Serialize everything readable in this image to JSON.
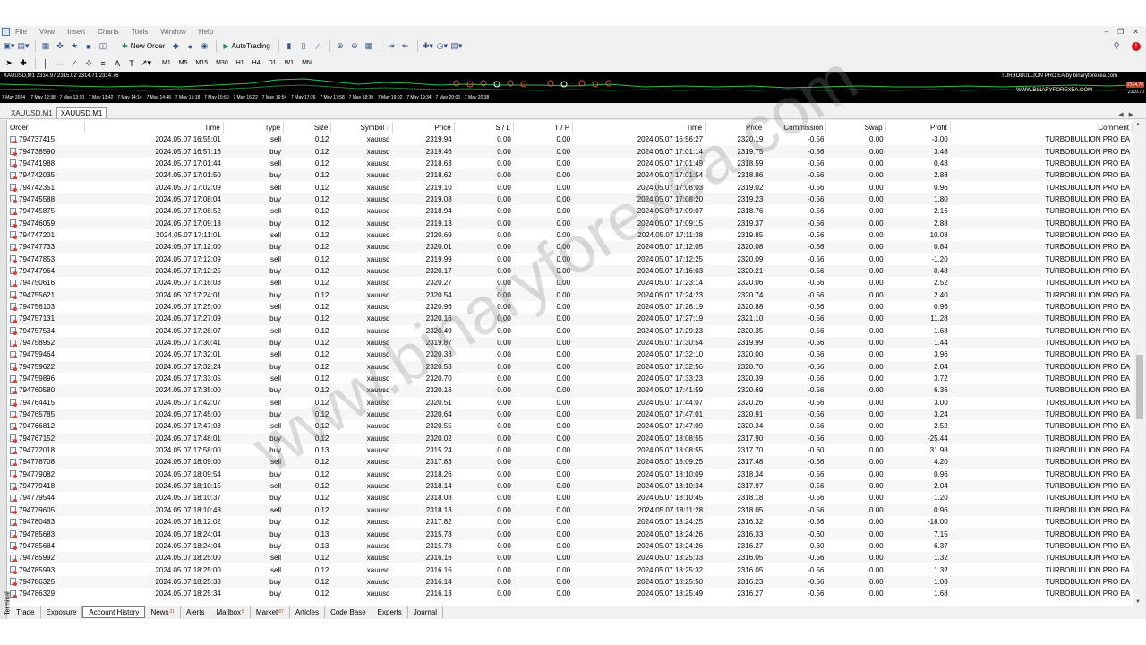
{
  "menu": [
    "File",
    "View",
    "Insert",
    "Charts",
    "Tools",
    "Window",
    "Help"
  ],
  "toolbar": {
    "new_order": "New Order",
    "autotrading": "AutoTrading"
  },
  "timeframes": [
    "M1",
    "M5",
    "M15",
    "M30",
    "H1",
    "H4",
    "D1",
    "W1",
    "MN"
  ],
  "chart": {
    "info": "XAUUSD,M1 2314.97 2315.02 2314.71 2314.76",
    "ea_label": "TURBOBULLION PRO EA by binaryforexea.com",
    "site": "WWW.BINARYFOREXEA.COM",
    "price_box": "2314.76",
    "price_label": "2310.70",
    "time_labels": [
      "7 May 2024",
      "7 May 12:38",
      "7 May 13:10",
      "7 May 13:42",
      "7 May 14:14",
      "7 May 14:46",
      "7 May 15:18",
      "7 May 15:50",
      "7 May 16:22",
      "7 May 16:54",
      "7 May 17:26",
      "7 May 17:58",
      "7 May 18:30",
      "7 May 19:02",
      "7 May 19:34",
      "7 May 20:06",
      "7 May 20:38"
    ]
  },
  "chart_tabs": [
    "XAUUSD,M1",
    "XAUUSD,M1"
  ],
  "terminal_label": "Terminal",
  "columns": {
    "order": "Order",
    "time": "Time",
    "type": "Type",
    "size": "Size",
    "symbol": "Symbol",
    "price": "Price",
    "sl": "S / L",
    "tp": "T / P",
    "close_time": "Time",
    "close_price": "Price",
    "commission": "Commission",
    "swap": "Swap",
    "profit": "Profit",
    "comment": "Comment"
  },
  "rows": [
    [
      "794737415",
      "2024.05.07 16:55:01",
      "sell",
      "0.12",
      "xauusd",
      "2319.94",
      "0.00",
      "0.00",
      "2024.05.07 16:56:27",
      "2320.19",
      "-0.56",
      "0.00",
      "-3.00",
      "TURBOBULLION PRO EA"
    ],
    [
      "794738590",
      "2024.05.07 16:57:16",
      "buy",
      "0.12",
      "xauusd",
      "2319.46",
      "0.00",
      "0.00",
      "2024.05.07 17:01:14",
      "2319.75",
      "-0.56",
      "0.00",
      "3.48",
      "TURBOBULLION PRO EA"
    ],
    [
      "794741988",
      "2024.05.07 17:01:44",
      "sell",
      "0.12",
      "xauusd",
      "2318.63",
      "0.00",
      "0.00",
      "2024.05.07 17:01:49",
      "2318.59",
      "-0.56",
      "0.00",
      "0.48",
      "TURBOBULLION PRO EA"
    ],
    [
      "794742035",
      "2024.05.07 17:01:50",
      "buy",
      "0.12",
      "xauusd",
      "2318.62",
      "0.00",
      "0.00",
      "2024.05.07 17:01:54",
      "2318.86",
      "-0.56",
      "0.00",
      "2.88",
      "TURBOBULLION PRO EA"
    ],
    [
      "794742351",
      "2024.05.07 17:02:09",
      "sell",
      "0.12",
      "xauusd",
      "2319.10",
      "0.00",
      "0.00",
      "2024.05.07 17:08:03",
      "2319.02",
      "-0.56",
      "0.00",
      "0.96",
      "TURBOBULLION PRO EA"
    ],
    [
      "794745588",
      "2024.05.07 17:08:04",
      "buy",
      "0.12",
      "xauusd",
      "2319.08",
      "0.00",
      "0.00",
      "2024.05.07 17:08:20",
      "2319.23",
      "-0.56",
      "0.00",
      "1.80",
      "TURBOBULLION PRO EA"
    ],
    [
      "794745875",
      "2024.05.07 17:08:52",
      "sell",
      "0.12",
      "xauusd",
      "2318.94",
      "0.00",
      "0.00",
      "2024.05.07 17:09:07",
      "2318.76",
      "-0.56",
      "0.00",
      "2.16",
      "TURBOBULLION PRO EA"
    ],
    [
      "794746059",
      "2024.05.07 17:09:13",
      "buy",
      "0.12",
      "xauusd",
      "2319.13",
      "0.00",
      "0.00",
      "2024.05.07 17:09:15",
      "2319.37",
      "-0.56",
      "0.00",
      "2.88",
      "TURBOBULLION PRO EA"
    ],
    [
      "794747201",
      "2024.05.07 17:11:01",
      "sell",
      "0.12",
      "xauusd",
      "2320.69",
      "0.00",
      "0.00",
      "2024.05.07 17:11:38",
      "2319.85",
      "-0.56",
      "0.00",
      "10.08",
      "TURBOBULLION PRO EA"
    ],
    [
      "794747733",
      "2024.05.07 17:12:00",
      "buy",
      "0.12",
      "xauusd",
      "2320.01",
      "0.00",
      "0.00",
      "2024.05.07 17:12:05",
      "2320.08",
      "-0.56",
      "0.00",
      "0.84",
      "TURBOBULLION PRO EA"
    ],
    [
      "794747853",
      "2024.05.07 17:12:09",
      "sell",
      "0.12",
      "xauusd",
      "2319.99",
      "0.00",
      "0.00",
      "2024.05.07 17:12:25",
      "2320.09",
      "-0.56",
      "0.00",
      "-1.20",
      "TURBOBULLION PRO EA"
    ],
    [
      "794747964",
      "2024.05.07 17:12:25",
      "buy",
      "0.12",
      "xauusd",
      "2320.17",
      "0.00",
      "0.00",
      "2024.05.07 17:16:03",
      "2320.21",
      "-0.56",
      "0.00",
      "0.48",
      "TURBOBULLION PRO EA"
    ],
    [
      "794750616",
      "2024.05.07 17:16:03",
      "sell",
      "0.12",
      "xauusd",
      "2320.27",
      "0.00",
      "0.00",
      "2024.05.07 17:23:14",
      "2320.06",
      "-0.56",
      "0.00",
      "2.52",
      "TURBOBULLION PRO EA"
    ],
    [
      "794755621",
      "2024.05.07 17:24:01",
      "buy",
      "0.12",
      "xauusd",
      "2320.54",
      "0.00",
      "0.00",
      "2024.05.07 17:24:23",
      "2320.74",
      "-0.56",
      "0.00",
      "2.40",
      "TURBOBULLION PRO EA"
    ],
    [
      "794756103",
      "2024.05.07 17:25:00",
      "sell",
      "0.12",
      "xauusd",
      "2320.96",
      "0.00",
      "0.00",
      "2024.05.07 17:26:19",
      "2320.88",
      "-0.56",
      "0.00",
      "0.96",
      "TURBOBULLION PRO EA"
    ],
    [
      "794757131",
      "2024.05.07 17:27:09",
      "buy",
      "0.12",
      "xauusd",
      "2320.16",
      "0.00",
      "0.00",
      "2024.05.07 17:27:19",
      "2321.10",
      "-0.56",
      "0.00",
      "11.28",
      "TURBOBULLION PRO EA"
    ],
    [
      "794757534",
      "2024.05.07 17:28:07",
      "sell",
      "0.12",
      "xauusd",
      "2320.49",
      "0.00",
      "0.00",
      "2024.05.07 17:29:23",
      "2320.35",
      "-0.56",
      "0.00",
      "1.68",
      "TURBOBULLION PRO EA"
    ],
    [
      "794758952",
      "2024.05.07 17:30:41",
      "buy",
      "0.12",
      "xauusd",
      "2319.87",
      "0.00",
      "0.00",
      "2024.05.07 17:30:54",
      "2319.99",
      "-0.56",
      "0.00",
      "1.44",
      "TURBOBULLION PRO EA"
    ],
    [
      "794759464",
      "2024.05.07 17:32:01",
      "sell",
      "0.12",
      "xauusd",
      "2320.33",
      "0.00",
      "0.00",
      "2024.05.07 17:32:10",
      "2320.00",
      "-0.56",
      "0.00",
      "3.96",
      "TURBOBULLION PRO EA"
    ],
    [
      "794759622",
      "2024.05.07 17:32:24",
      "buy",
      "0.12",
      "xauusd",
      "2320.53",
      "0.00",
      "0.00",
      "2024.05.07 17:32:56",
      "2320.70",
      "-0.56",
      "0.00",
      "2.04",
      "TURBOBULLION PRO EA"
    ],
    [
      "794759896",
      "2024.05.07 17:33:05",
      "sell",
      "0.12",
      "xauusd",
      "2320.70",
      "0.00",
      "0.00",
      "2024.05.07 17:33:23",
      "2320.39",
      "-0.56",
      "0.00",
      "3.72",
      "TURBOBULLION PRO EA"
    ],
    [
      "794760580",
      "2024.05.07 17:35:00",
      "buy",
      "0.12",
      "xauusd",
      "2320.16",
      "0.00",
      "0.00",
      "2024.05.07 17:41:59",
      "2320.69",
      "-0.56",
      "0.00",
      "6.36",
      "TURBOBULLION PRO EA"
    ],
    [
      "794764415",
      "2024.05.07 17:42:07",
      "sell",
      "0.12",
      "xauusd",
      "2320.51",
      "0.00",
      "0.00",
      "2024.05.07 17:44:07",
      "2320.26",
      "-0.56",
      "0.00",
      "3.00",
      "TURBOBULLION PRO EA"
    ],
    [
      "794765785",
      "2024.05.07 17:45:00",
      "buy",
      "0.12",
      "xauusd",
      "2320.64",
      "0.00",
      "0.00",
      "2024.05.07 17:47:01",
      "2320.91",
      "-0.56",
      "0.00",
      "3.24",
      "TURBOBULLION PRO EA"
    ],
    [
      "794766812",
      "2024.05.07 17:47:03",
      "sell",
      "0.12",
      "xauusd",
      "2320.55",
      "0.00",
      "0.00",
      "2024.05.07 17:47:09",
      "2320.34",
      "-0.56",
      "0.00",
      "2.52",
      "TURBOBULLION PRO EA"
    ],
    [
      "794767152",
      "2024.05.07 17:48:01",
      "buy",
      "0.12",
      "xauusd",
      "2320.02",
      "0.00",
      "0.00",
      "2024.05.07 18:08:55",
      "2317.90",
      "-0.56",
      "0.00",
      "-25.44",
      "TURBOBULLION PRO EA"
    ],
    [
      "794772018",
      "2024.05.07 17:58:00",
      "buy",
      "0.13",
      "xauusd",
      "2315.24",
      "0.00",
      "0.00",
      "2024.05.07 18:08:55",
      "2317.70",
      "-0.60",
      "0.00",
      "31.98",
      "TURBOBULLION PRO EA"
    ],
    [
      "794778708",
      "2024.05.07 18:09:00",
      "sell",
      "0.12",
      "xauusd",
      "2317.83",
      "0.00",
      "0.00",
      "2024.05.07 18:09:25",
      "2317.48",
      "-0.56",
      "0.00",
      "4.20",
      "TURBOBULLION PRO EA"
    ],
    [
      "794779082",
      "2024.05.07 18:09:54",
      "buy",
      "0.12",
      "xauusd",
      "2318.26",
      "0.00",
      "0.00",
      "2024.05.07 18:10:09",
      "2318.34",
      "-0.56",
      "0.00",
      "0.96",
      "TURBOBULLION PRO EA"
    ],
    [
      "794779418",
      "2024.05.07 18:10:15",
      "sell",
      "0.12",
      "xauusd",
      "2318.14",
      "0.00",
      "0.00",
      "2024.05.07 18:10:34",
      "2317.97",
      "-0.56",
      "0.00",
      "2.04",
      "TURBOBULLION PRO EA"
    ],
    [
      "794779544",
      "2024.05.07 18:10:37",
      "buy",
      "0.12",
      "xauusd",
      "2318.08",
      "0.00",
      "0.00",
      "2024.05.07 18:10:45",
      "2318.18",
      "-0.56",
      "0.00",
      "1.20",
      "TURBOBULLION PRO EA"
    ],
    [
      "794779605",
      "2024.05.07 18:10:48",
      "sell",
      "0.12",
      "xauusd",
      "2318.13",
      "0.00",
      "0.00",
      "2024.05.07 18:11:28",
      "2318.05",
      "-0.56",
      "0.00",
      "0.96",
      "TURBOBULLION PRO EA"
    ],
    [
      "794780483",
      "2024.05.07 18:12:02",
      "buy",
      "0.12",
      "xauusd",
      "2317.82",
      "0.00",
      "0.00",
      "2024.05.07 18:24:25",
      "2316.32",
      "-0.56",
      "0.00",
      "-18.00",
      "TURBOBULLION PRO EA"
    ],
    [
      "794785683",
      "2024.05.07 18:24:04",
      "buy",
      "0.13",
      "xauusd",
      "2315.78",
      "0.00",
      "0.00",
      "2024.05.07 18:24:26",
      "2316.33",
      "-0.60",
      "0.00",
      "7.15",
      "TURBOBULLION PRO EA"
    ],
    [
      "794785684",
      "2024.05.07 18:24:04",
      "buy",
      "0.13",
      "xauusd",
      "2315.78",
      "0.00",
      "0.00",
      "2024.05.07 18:24:26",
      "2316.27",
      "-0.60",
      "0.00",
      "6.37",
      "TURBOBULLION PRO EA"
    ],
    [
      "794785992",
      "2024.05.07 18:25:00",
      "sell",
      "0.12",
      "xauusd",
      "2316.16",
      "0.00",
      "0.00",
      "2024.05.07 18:25:33",
      "2316.05",
      "-0.56",
      "0.00",
      "1.32",
      "TURBOBULLION PRO EA"
    ],
    [
      "794785993",
      "2024.05.07 18:25:00",
      "sell",
      "0.12",
      "xauusd",
      "2316.16",
      "0.00",
      "0.00",
      "2024.05.07 18:25:32",
      "2316.05",
      "-0.56",
      "0.00",
      "1.32",
      "TURBOBULLION PRO EA"
    ],
    [
      "794786325",
      "2024.05.07 18:25:33",
      "buy",
      "0.12",
      "xauusd",
      "2316.14",
      "0.00",
      "0.00",
      "2024.05.07 18:25:50",
      "2316.23",
      "-0.56",
      "0.00",
      "1.08",
      "TURBOBULLION PRO EA"
    ],
    [
      "794786329",
      "2024.05.07 18:25:34",
      "buy",
      "0.12",
      "xauusd",
      "2316.13",
      "0.00",
      "0.00",
      "2024.05.07 18:25:49",
      "2316.27",
      "-0.56",
      "0.00",
      "1.68",
      "TURBOBULLION PRO EA"
    ]
  ],
  "bottom_tabs": [
    {
      "label": "Trade",
      "badge": ""
    },
    {
      "label": "Exposure",
      "badge": ""
    },
    {
      "label": "Account History",
      "badge": ""
    },
    {
      "label": "News",
      "badge": "21"
    },
    {
      "label": "Alerts",
      "badge": ""
    },
    {
      "label": "Mailbox",
      "badge": "8"
    },
    {
      "label": "Market",
      "badge": "87"
    },
    {
      "label": "Articles",
      "badge": ""
    },
    {
      "label": "Code Base",
      "badge": ""
    },
    {
      "label": "Experts",
      "badge": ""
    },
    {
      "label": "Journal",
      "badge": ""
    }
  ],
  "active_bottom_tab": "Account History",
  "watermark": "www.binaryforexea.com",
  "colors": {
    "badge": "#c0392b",
    "alert": "#d81818",
    "chart_bg": "#000000"
  }
}
